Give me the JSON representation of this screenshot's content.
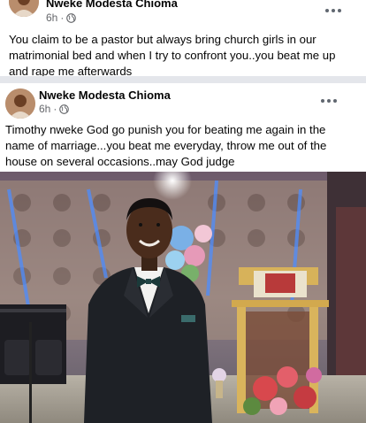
{
  "posts": [
    {
      "author": "Nweke Modesta Chioma",
      "time": "6h",
      "separator": "·",
      "text": "You claim to be a pastor but always bring church girls in our matrimonial bed and when I try to confront you..you beat me up and rape me afterwards"
    },
    {
      "author": "Nweke Modesta Chioma",
      "time": "6h",
      "separator": "·",
      "text": "Timothy nweke God go punish you for beating me again in the name of marriage...you beat me everyday, throw me out of the house on several occasions..may God judge"
    }
  ],
  "icons": {
    "audience": "globe-icon",
    "more": "more-options-icon"
  },
  "colors": {
    "meta_text": "#65676b",
    "divider": "#e4e6eb"
  }
}
